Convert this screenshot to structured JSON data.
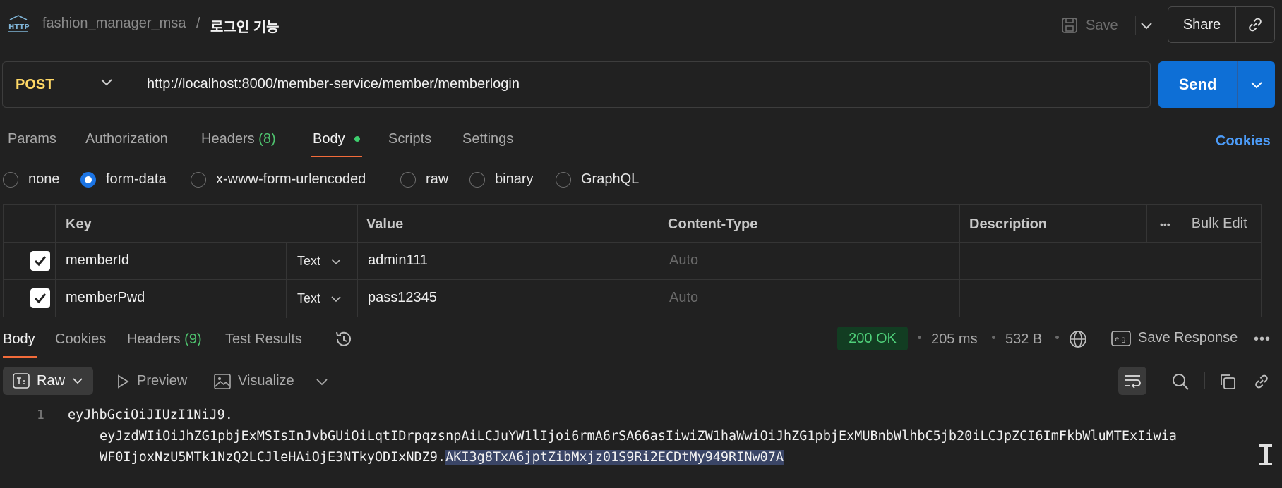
{
  "header": {
    "collection": "fashion_manager_msa",
    "separator": "/",
    "request_name": "로그인 기능",
    "save_label": "Save",
    "share_label": "Share"
  },
  "request": {
    "method": "POST",
    "url": "http://localhost:8000/member-service/member/memberlogin",
    "send_label": "Send"
  },
  "request_tabs": {
    "params": "Params",
    "authorization": "Authorization",
    "headers": "Headers",
    "headers_count": "(8)",
    "body": "Body",
    "scripts": "Scripts",
    "settings": "Settings",
    "cookies": "Cookies"
  },
  "body_types": {
    "none": "none",
    "form_data": "form-data",
    "urlencoded": "x-www-form-urlencoded",
    "raw": "raw",
    "binary": "binary",
    "graphql": "GraphQL",
    "selected": "form-data"
  },
  "form_table": {
    "columns": {
      "key": "Key",
      "value": "Value",
      "content_type": "Content-Type",
      "description": "Description",
      "bulk_edit": "Bulk Edit"
    },
    "rows": [
      {
        "key": "memberId",
        "type": "Text",
        "value": "admin111",
        "content_type": "Auto",
        "checked": true
      },
      {
        "key": "memberPwd",
        "type": "Text",
        "value": "pass12345",
        "content_type": "Auto",
        "checked": true
      }
    ]
  },
  "response": {
    "tabs": {
      "body": "Body",
      "cookies": "Cookies",
      "headers": "Headers",
      "headers_count": "(9)",
      "test_results": "Test Results"
    },
    "status": "200 OK",
    "time": "205 ms",
    "size": "532 B",
    "save_response": "Save Response",
    "more": "•••",
    "format": "Raw",
    "preview": "Preview",
    "visualize": "Visualize",
    "line_number": "1",
    "token_line1": "eyJhbGciOiJIUzI1NiJ9.",
    "token_line2": "eyJzdWIiOiJhZG1pbjExMSIsInJvbGUiOiLqtIDrpqzsnpAiLCJuYW1lIjoi6rmA6rSA66asIiwiZW1haWwiOiJhZG1pbjExMUBnbWlhbC5jb20iLCJpZCI6ImFkbWluMTExIiwia",
    "token_line3": "WF0IjoxNzU5MTk1NzQ2LCJleHAiOjE3NTkyODIxNDZ9.",
    "token_selected": "AKI3g8TxA6jptZibMxjz01S9Ri2ECDtMy949RINw07A"
  },
  "colors": {
    "background": "#212121",
    "method": "#ffd866",
    "send": "#0e6fd6",
    "active_tab_underline": "#f26b3a",
    "count_green": "#4fc46f",
    "cookies_link": "#4c9bf7",
    "status_bg": "#123d22",
    "status_text": "#4fd07a"
  },
  "icons": [
    "http-icon",
    "save-icon",
    "chevron-down-icon",
    "link-icon",
    "history-icon",
    "globe-icon",
    "example-icon",
    "text-format-icon",
    "play-icon",
    "image-icon",
    "wrap-icon",
    "search-icon",
    "copy-icon",
    "check-icon",
    "text-cursor-icon"
  ]
}
